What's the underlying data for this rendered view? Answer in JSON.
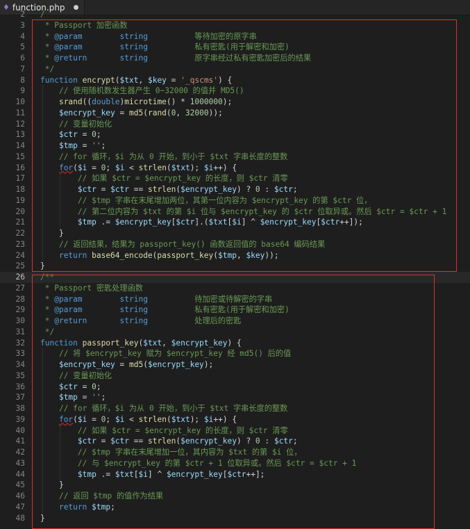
{
  "tab": {
    "icon": "php-file-icon",
    "filename": "function.php",
    "dirty_marker": "●"
  },
  "lines": [
    {
      "n": "2",
      "tokens": [
        [
          "c",
          "/"
        ]
      ]
    },
    {
      "n": "3",
      "tokens": [
        [
          "c",
          " * Passport 加密函数"
        ]
      ]
    },
    {
      "n": "4",
      "tokens": [
        [
          "c",
          " * "
        ],
        [
          "ck",
          "@param"
        ],
        [
          "c",
          "        "
        ],
        [
          "ck",
          "string"
        ],
        [
          "c",
          "          等待加密的原字串"
        ]
      ]
    },
    {
      "n": "5",
      "tokens": [
        [
          "c",
          " * "
        ],
        [
          "ck",
          "@param"
        ],
        [
          "c",
          "        "
        ],
        [
          "ck",
          "string"
        ],
        [
          "c",
          "          私有密匙(用于解密和加密)"
        ]
      ]
    },
    {
      "n": "6",
      "tokens": [
        [
          "c",
          " * "
        ],
        [
          "ck",
          "@return"
        ],
        [
          "c",
          "       "
        ],
        [
          "ck",
          "string"
        ],
        [
          "c",
          "          原字串经过私有密匙加密后的结果"
        ]
      ]
    },
    {
      "n": "7",
      "tokens": [
        [
          "c",
          " */"
        ]
      ]
    },
    {
      "n": "8",
      "tokens": [
        [
          "kw",
          "function "
        ],
        [
          "fn",
          "encrypt"
        ],
        [
          "op",
          "("
        ],
        [
          "vr",
          "$txt"
        ],
        [
          "op",
          ", "
        ],
        [
          "vr",
          "$key"
        ],
        [
          "op",
          " = "
        ],
        [
          "st",
          "'_qscms'"
        ],
        [
          "op",
          ") {"
        ]
      ]
    },
    {
      "n": "9",
      "tokens": [
        [
          "op",
          "    "
        ],
        [
          "c",
          "// 使用随机数发生器产生 0~32000 的值并 MD5()"
        ]
      ]
    },
    {
      "n": "10",
      "tokens": [
        [
          "op",
          "    "
        ],
        [
          "fn",
          "srand"
        ],
        [
          "op",
          "(("
        ],
        [
          "ty",
          "double"
        ],
        [
          "op",
          ")"
        ],
        [
          "fn",
          "microtime"
        ],
        [
          "op",
          "() * "
        ],
        [
          "nm",
          "1000000"
        ],
        [
          "op",
          ");"
        ]
      ]
    },
    {
      "n": "11",
      "tokens": [
        [
          "op",
          "    "
        ],
        [
          "vr",
          "$encrypt_key"
        ],
        [
          "op",
          " = "
        ],
        [
          "fn",
          "md5"
        ],
        [
          "op",
          "("
        ],
        [
          "fn",
          "rand"
        ],
        [
          "op",
          "("
        ],
        [
          "nm",
          "0"
        ],
        [
          "op",
          ", "
        ],
        [
          "nm",
          "32000"
        ],
        [
          "op",
          "));"
        ]
      ]
    },
    {
      "n": "12",
      "tokens": [
        [
          "op",
          "    "
        ],
        [
          "c",
          "// 变量初始化"
        ]
      ]
    },
    {
      "n": "13",
      "tokens": [
        [
          "op",
          "    "
        ],
        [
          "vr",
          "$ctr"
        ],
        [
          "op",
          " = "
        ],
        [
          "nm",
          "0"
        ],
        [
          "op",
          ";"
        ]
      ]
    },
    {
      "n": "14",
      "tokens": [
        [
          "op",
          "    "
        ],
        [
          "vr",
          "$tmp"
        ],
        [
          "op",
          " = "
        ],
        [
          "st",
          "''"
        ],
        [
          "op",
          ";"
        ]
      ]
    },
    {
      "n": "15",
      "tokens": [
        [
          "op",
          "    "
        ],
        [
          "c",
          "// for 循环，$i 为从 0 开始，到小于 $txt 字串长度的整数"
        ]
      ]
    },
    {
      "n": "16",
      "tokens": [
        [
          "op",
          "    "
        ],
        [
          "kws",
          "for"
        ],
        [
          "op",
          "("
        ],
        [
          "vr",
          "$i"
        ],
        [
          "op",
          " = "
        ],
        [
          "nm",
          "0"
        ],
        [
          "op",
          "; "
        ],
        [
          "vr",
          "$i"
        ],
        [
          "op",
          " < "
        ],
        [
          "fn",
          "strlen"
        ],
        [
          "op",
          "("
        ],
        [
          "vr",
          "$txt"
        ],
        [
          "op",
          "); "
        ],
        [
          "vr",
          "$i"
        ],
        [
          "op",
          "++) {"
        ]
      ]
    },
    {
      "n": "17",
      "tokens": [
        [
          "op",
          "        "
        ],
        [
          "c",
          "// 如果 $ctr = $encrypt_key 的长度，则 $ctr 清零"
        ]
      ]
    },
    {
      "n": "18",
      "tokens": [
        [
          "op",
          "        "
        ],
        [
          "vr",
          "$ctr"
        ],
        [
          "op",
          " = "
        ],
        [
          "vr",
          "$ctr"
        ],
        [
          "op",
          " == "
        ],
        [
          "fn",
          "strlen"
        ],
        [
          "op",
          "("
        ],
        [
          "vr",
          "$encrypt_key"
        ],
        [
          "op",
          ") ? "
        ],
        [
          "nm",
          "0"
        ],
        [
          "op",
          " : "
        ],
        [
          "vr",
          "$ctr"
        ],
        [
          "op",
          ";"
        ]
      ]
    },
    {
      "n": "19",
      "tokens": [
        [
          "op",
          "        "
        ],
        [
          "c",
          "// $tmp 字串在末尾增加两位，其第一位内容为 $encrypt_key 的第 $ctr 位，"
        ]
      ]
    },
    {
      "n": "20",
      "tokens": [
        [
          "op",
          "        "
        ],
        [
          "c",
          "// 第二位内容为 $txt 的第 $i 位与 $encrypt_key 的 $ctr 位取异或。然后 $ctr = $ctr + 1"
        ]
      ]
    },
    {
      "n": "21",
      "tokens": [
        [
          "op",
          "        "
        ],
        [
          "vr",
          "$tmp"
        ],
        [
          "op",
          " .= "
        ],
        [
          "vr",
          "$encrypt_key"
        ],
        [
          "op",
          "["
        ],
        [
          "vr",
          "$ctr"
        ],
        [
          "op",
          "].("
        ],
        [
          "vr",
          "$txt"
        ],
        [
          "op",
          "["
        ],
        [
          "vr",
          "$i"
        ],
        [
          "op",
          "] ^ "
        ],
        [
          "vr",
          "$encrypt_key"
        ],
        [
          "op",
          "["
        ],
        [
          "vr",
          "$ctr"
        ],
        [
          "op",
          "++]);"
        ]
      ]
    },
    {
      "n": "22",
      "tokens": [
        [
          "op",
          "    }"
        ]
      ]
    },
    {
      "n": "23",
      "tokens": [
        [
          "op",
          "    "
        ],
        [
          "c",
          "// 返回结果，结果为 passport_key() 函数返回值的 base64 编码结果"
        ]
      ]
    },
    {
      "n": "24",
      "tokens": [
        [
          "op",
          "    "
        ],
        [
          "kw",
          "return "
        ],
        [
          "fn",
          "base64_encode"
        ],
        [
          "op",
          "("
        ],
        [
          "fn",
          "passport_key"
        ],
        [
          "op",
          "("
        ],
        [
          "vr",
          "$tmp"
        ],
        [
          "op",
          ", "
        ],
        [
          "vr",
          "$key"
        ],
        [
          "op",
          "));"
        ]
      ]
    },
    {
      "n": "25",
      "tokens": [
        [
          "op",
          "}"
        ]
      ]
    },
    {
      "n": "26",
      "tokens": [
        [
          "c",
          "/**"
        ]
      ]
    },
    {
      "n": "27",
      "tokens": [
        [
          "c",
          " * Passport 密匙处理函数"
        ]
      ]
    },
    {
      "n": "28",
      "tokens": [
        [
          "c",
          " * "
        ],
        [
          "ck",
          "@param"
        ],
        [
          "c",
          "        "
        ],
        [
          "ck",
          "string"
        ],
        [
          "c",
          "          待加密或待解密的字串"
        ]
      ]
    },
    {
      "n": "29",
      "tokens": [
        [
          "c",
          " * "
        ],
        [
          "ck",
          "@param"
        ],
        [
          "c",
          "        "
        ],
        [
          "ck",
          "string"
        ],
        [
          "c",
          "          私有密匙(用于解密和加密)"
        ]
      ]
    },
    {
      "n": "30",
      "tokens": [
        [
          "c",
          " * "
        ],
        [
          "ck",
          "@return"
        ],
        [
          "c",
          "       "
        ],
        [
          "ck",
          "string"
        ],
        [
          "c",
          "          处理后的密匙"
        ]
      ]
    },
    {
      "n": "31",
      "tokens": [
        [
          "c",
          " */"
        ]
      ]
    },
    {
      "n": "32",
      "tokens": [
        [
          "kw",
          "function "
        ],
        [
          "fn",
          "passport_key"
        ],
        [
          "op",
          "("
        ],
        [
          "vr",
          "$txt"
        ],
        [
          "op",
          ", "
        ],
        [
          "vr",
          "$encrypt_key"
        ],
        [
          "op",
          ") {"
        ]
      ]
    },
    {
      "n": "33",
      "tokens": [
        [
          "op",
          "    "
        ],
        [
          "c",
          "// 将 $encrypt_key 赋为 $encrypt_key 经 md5() 后的值"
        ]
      ]
    },
    {
      "n": "34",
      "tokens": [
        [
          "op",
          "    "
        ],
        [
          "vr",
          "$encrypt_key"
        ],
        [
          "op",
          " = "
        ],
        [
          "fn",
          "md5"
        ],
        [
          "op",
          "("
        ],
        [
          "vr",
          "$encrypt_key"
        ],
        [
          "op",
          ");"
        ]
      ]
    },
    {
      "n": "35",
      "tokens": [
        [
          "op",
          "    "
        ],
        [
          "c",
          "// 变量初始化"
        ]
      ]
    },
    {
      "n": "36",
      "tokens": [
        [
          "op",
          "    "
        ],
        [
          "vr",
          "$ctr"
        ],
        [
          "op",
          " = "
        ],
        [
          "nm",
          "0"
        ],
        [
          "op",
          ";"
        ]
      ]
    },
    {
      "n": "37",
      "tokens": [
        [
          "op",
          "    "
        ],
        [
          "vr",
          "$tmp"
        ],
        [
          "op",
          " = "
        ],
        [
          "st",
          "''"
        ],
        [
          "op",
          ";"
        ]
      ]
    },
    {
      "n": "38",
      "tokens": [
        [
          "op",
          "    "
        ],
        [
          "c",
          "// for 循环，$i 为从 0 开始，到小于 $txt 字串长度的整数"
        ]
      ]
    },
    {
      "n": "39",
      "tokens": [
        [
          "op",
          "    "
        ],
        [
          "kws",
          "for"
        ],
        [
          "op",
          "("
        ],
        [
          "vr",
          "$i"
        ],
        [
          "op",
          " = "
        ],
        [
          "nm",
          "0"
        ],
        [
          "op",
          "; "
        ],
        [
          "vr",
          "$i"
        ],
        [
          "op",
          " < "
        ],
        [
          "fn",
          "strlen"
        ],
        [
          "op",
          "("
        ],
        [
          "vr",
          "$txt"
        ],
        [
          "op",
          "); "
        ],
        [
          "vr",
          "$i"
        ],
        [
          "op",
          "++) {"
        ]
      ]
    },
    {
      "n": "40",
      "tokens": [
        [
          "op",
          "        "
        ],
        [
          "c",
          "// 如果 $ctr = $encrypt_key 的长度，则 $ctr 清零"
        ]
      ]
    },
    {
      "n": "41",
      "tokens": [
        [
          "op",
          "        "
        ],
        [
          "vr",
          "$ctr"
        ],
        [
          "op",
          " = "
        ],
        [
          "vr",
          "$ctr"
        ],
        [
          "op",
          " == "
        ],
        [
          "fn",
          "strlen"
        ],
        [
          "op",
          "("
        ],
        [
          "vr",
          "$encrypt_key"
        ],
        [
          "op",
          ") ? "
        ],
        [
          "nm",
          "0"
        ],
        [
          "op",
          " : "
        ],
        [
          "vr",
          "$ctr"
        ],
        [
          "op",
          ";"
        ]
      ]
    },
    {
      "n": "42",
      "tokens": [
        [
          "op",
          "        "
        ],
        [
          "c",
          "// $tmp 字串在末尾增加一位，其内容为 $txt 的第 $i 位，"
        ]
      ]
    },
    {
      "n": "43",
      "tokens": [
        [
          "op",
          "        "
        ],
        [
          "c",
          "// 与 $encrypt_key 的第 $ctr + 1 位取异或。然后 $ctr = $ctr + 1"
        ]
      ]
    },
    {
      "n": "44",
      "tokens": [
        [
          "op",
          "        "
        ],
        [
          "vr",
          "$tmp"
        ],
        [
          "op",
          " .= "
        ],
        [
          "vr",
          "$txt"
        ],
        [
          "op",
          "["
        ],
        [
          "vr",
          "$i"
        ],
        [
          "op",
          "] ^ "
        ],
        [
          "vr",
          "$encrypt_key"
        ],
        [
          "op",
          "["
        ],
        [
          "vr",
          "$ctr"
        ],
        [
          "op",
          "++];"
        ]
      ]
    },
    {
      "n": "45",
      "tokens": [
        [
          "op",
          "    }"
        ]
      ]
    },
    {
      "n": "46",
      "tokens": [
        [
          "op",
          "    "
        ],
        [
          "c",
          "// 返回 $tmp 的值作为结果"
        ]
      ]
    },
    {
      "n": "47",
      "tokens": [
        [
          "op",
          "    "
        ],
        [
          "kw",
          "return "
        ],
        [
          "vr",
          "$tmp"
        ],
        [
          "op",
          ";"
        ]
      ]
    },
    {
      "n": "48",
      "tokens": [
        [
          "op",
          "}"
        ]
      ]
    }
  ],
  "active_line": "26"
}
